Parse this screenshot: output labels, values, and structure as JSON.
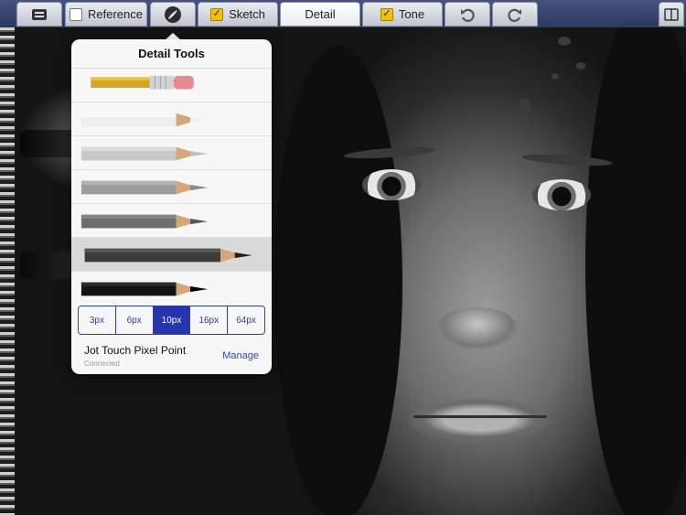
{
  "toolbar": {
    "tabs": [
      {
        "label": "Reference",
        "checked": false
      },
      {
        "label": "Sketch",
        "checked": true
      },
      {
        "label": "Detail",
        "checked": null
      },
      {
        "label": "Tone",
        "checked": true
      }
    ],
    "icons": [
      "layers-icon",
      "brush-icon",
      "undo-icon",
      "redo-icon",
      "book-icon"
    ]
  },
  "popover": {
    "title": "Detail Tools",
    "tools": [
      {
        "name": "eraser",
        "selected": false
      },
      {
        "name": "pencil-white",
        "selected": false
      },
      {
        "name": "pencil-light-gray",
        "selected": false
      },
      {
        "name": "pencil-gray",
        "selected": false
      },
      {
        "name": "pencil-dark-gray",
        "selected": false
      },
      {
        "name": "pencil-charcoal",
        "selected": true
      },
      {
        "name": "pencil-black",
        "selected": false
      }
    ],
    "sizes": [
      "3px",
      "6px",
      "10px",
      "16px",
      "64px"
    ],
    "selected_size": "10px",
    "stylus": {
      "name": "Jot Touch Pixel Point",
      "status": "Connected",
      "action": "Manage"
    }
  },
  "colors": {
    "accent": "#2634b0",
    "toolbar": "#2c3a61",
    "highlight": "#f2c200"
  }
}
